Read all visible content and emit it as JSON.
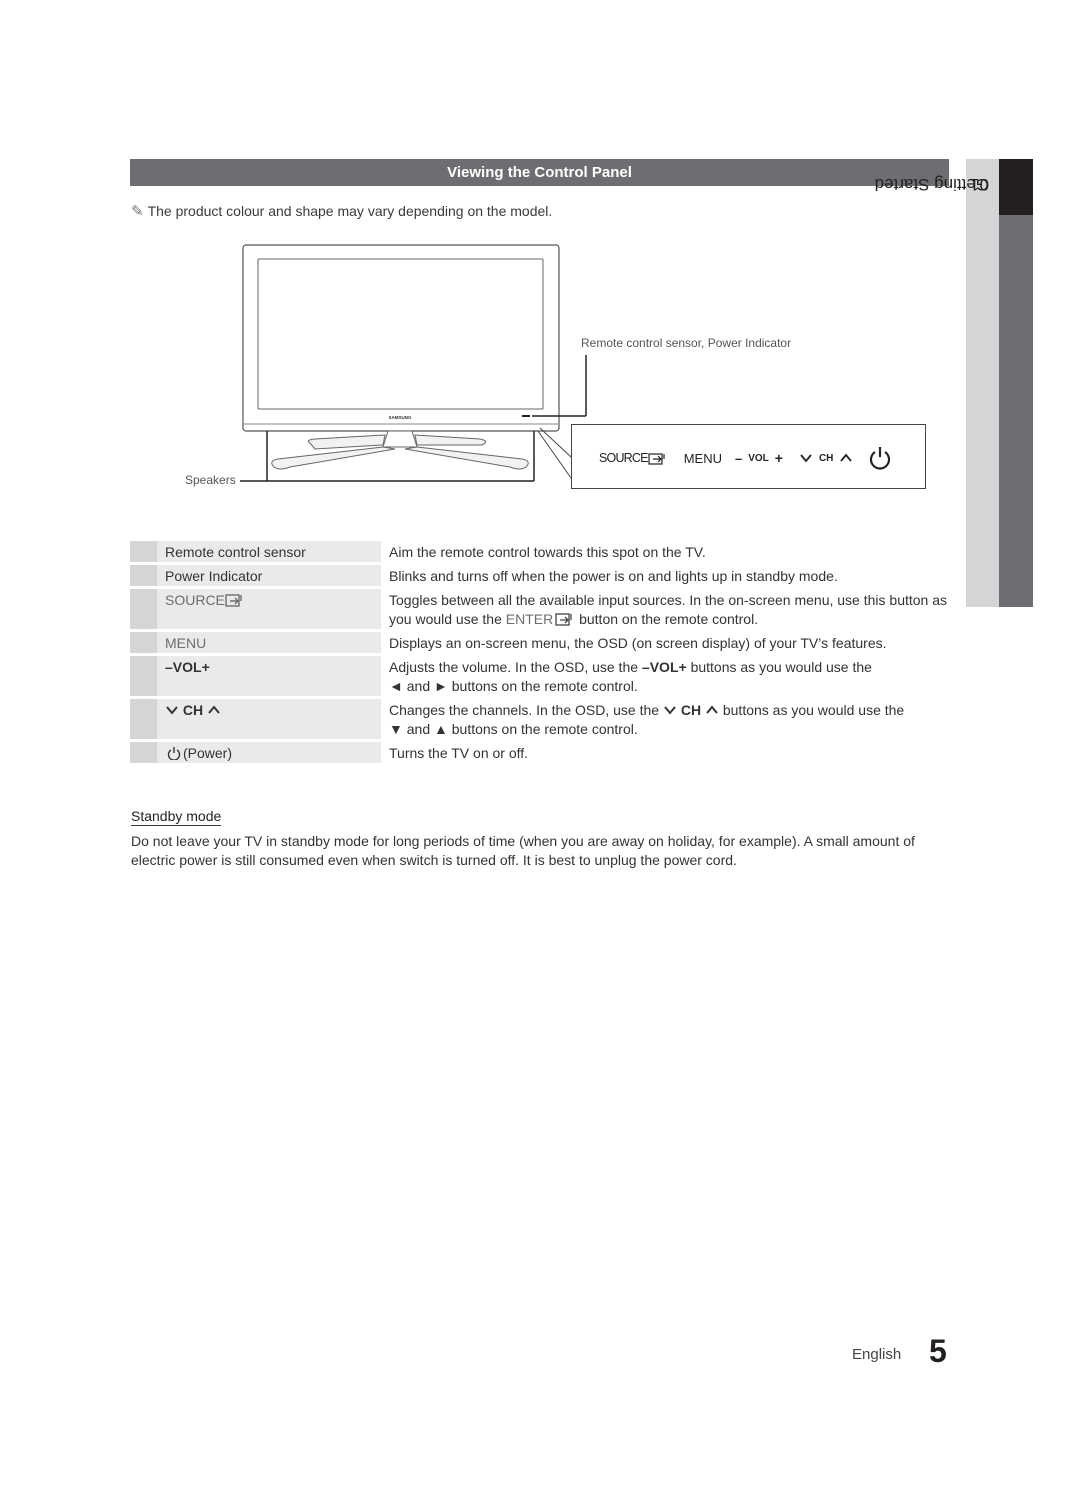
{
  "section": {
    "title": "Viewing the Control Panel",
    "note_icon": "pencil-note-icon",
    "note": "The product colour and shape may vary depending on the model."
  },
  "side_tab": {
    "chapter": "01",
    "label": "Getting Started"
  },
  "diagram": {
    "brand": "SAMSUNG",
    "sensor_label": "Remote control sensor, Power Indicator",
    "speakers_label": "Speakers",
    "panel_buttons": {
      "source": "SOURCE",
      "menu": "MENU",
      "vol_minus": "–",
      "vol": "VOL",
      "vol_plus": "+",
      "ch": "CH",
      "power_icon": "power-icon"
    }
  },
  "table": {
    "rows": [
      {
        "name": "Remote control sensor",
        "desc": "Aim the remote control towards this spot on the TV."
      },
      {
        "name": "Power Indicator",
        "desc": "Blinks and turns off when the power is on and lights up in standby mode."
      },
      {
        "name": "SOURCE",
        "desc_a": "Toggles between all the available input sources. In the on-screen menu, use this button as you would use the ",
        "desc_enter": "ENTER",
        "desc_b": " button on the remote control."
      },
      {
        "name": "MENU",
        "desc": "Displays an on-screen menu, the OSD (on screen display) of your TV’s features."
      },
      {
        "name_minus": "–",
        "name": "VOL",
        "name_plus": "+",
        "desc_a": "Adjusts the volume. In the OSD, use the ",
        "desc_key": "VOL",
        "desc_b": " buttons as you would use the",
        "desc_c": "◄ and ► buttons on the remote control."
      },
      {
        "name": "CH",
        "desc_a": "Changes the channels. In the OSD, use the ",
        "desc_key": "CH",
        "desc_b": " buttons as you would use the",
        "desc_c": "▼ and ▲ buttons on the remote control."
      },
      {
        "name": "(Power)",
        "desc": "Turns the TV on or off."
      }
    ]
  },
  "standby": {
    "title": "Standby mode",
    "text": "Do not leave your TV in standby mode for long periods of time (when you are away on holiday, for example). A small amount of electric power is still consumed even when switch is turned off. It is best to unplug the power cord."
  },
  "footer": {
    "language": "English",
    "page_number": "5"
  }
}
